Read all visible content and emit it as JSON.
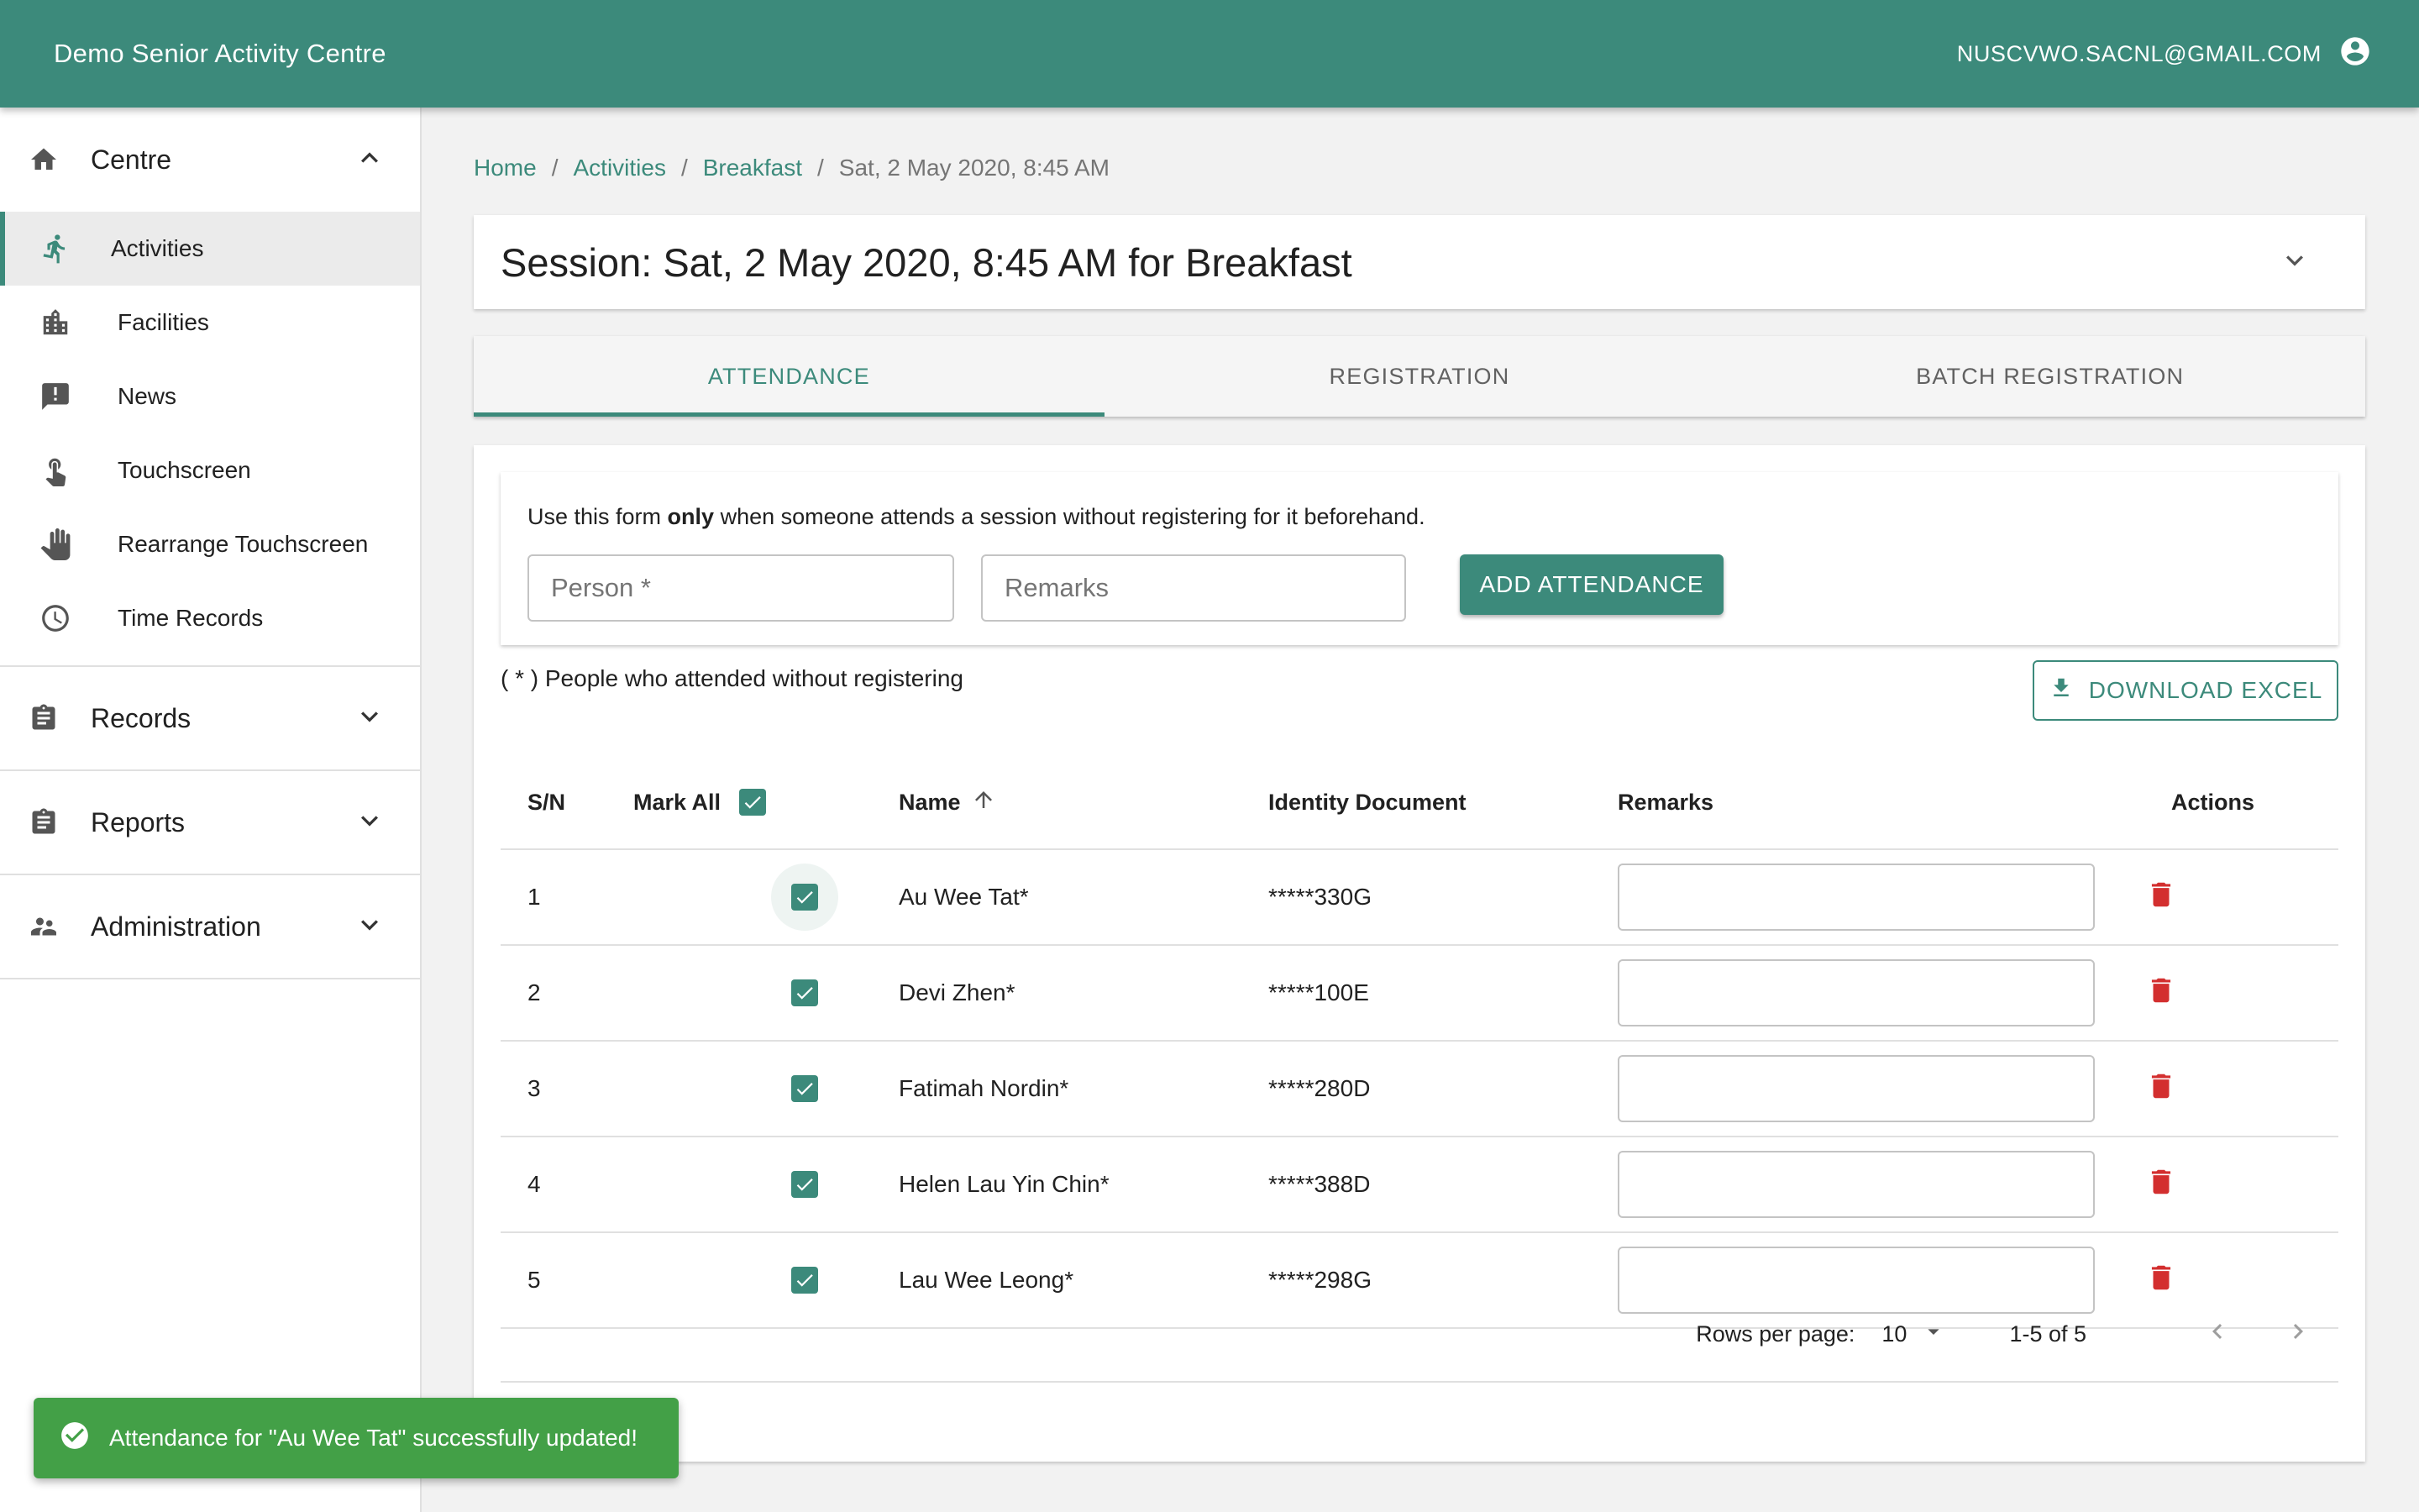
{
  "app": {
    "title": "Demo Senior Activity Centre",
    "account_email": "NUSCVWO.SACNL@GMAIL.COM"
  },
  "sidebar": {
    "groups": [
      {
        "label": "Centre",
        "icon": "home-icon",
        "expanded": true,
        "items": [
          {
            "label": "Activities",
            "icon": "run-icon",
            "active": true
          },
          {
            "label": "Facilities",
            "icon": "building-icon"
          },
          {
            "label": "News",
            "icon": "announcement-icon"
          },
          {
            "label": "Touchscreen",
            "icon": "touch-icon"
          },
          {
            "label": "Rearrange Touchscreen",
            "icon": "hand-icon"
          },
          {
            "label": "Time Records",
            "icon": "clock-icon"
          }
        ]
      },
      {
        "label": "Records",
        "icon": "clipboard-icon",
        "expanded": false
      },
      {
        "label": "Reports",
        "icon": "clipboard-icon",
        "expanded": false
      },
      {
        "label": "Administration",
        "icon": "people-icon",
        "expanded": false
      }
    ]
  },
  "breadcrumb": {
    "items": [
      "Home",
      "Activities",
      "Breakfast"
    ],
    "current": "Sat, 2 May 2020, 8:45 AM"
  },
  "session": {
    "title": "Session: Sat, 2 May 2020, 8:45 AM for Breakfast"
  },
  "tabs": [
    {
      "label": "ATTENDANCE",
      "active": true
    },
    {
      "label": "REGISTRATION",
      "active": false
    },
    {
      "label": "BATCH REGISTRATION",
      "active": false
    }
  ],
  "form": {
    "note_prefix": "Use this form ",
    "note_bold": "only",
    "note_suffix": " when someone attends a session without registering for it beforehand.",
    "person_placeholder": "Person *",
    "remarks_placeholder": "Remarks",
    "add_label": "ADD ATTENDANCE"
  },
  "legend_note": "( * ) People who attended without registering",
  "download_label": "DOWNLOAD EXCEL",
  "table": {
    "columns": {
      "sn": "S/N",
      "mark_all": "Mark All",
      "name": "Name",
      "identity": "Identity Document",
      "remarks": "Remarks",
      "actions": "Actions"
    },
    "rows": [
      {
        "sn": "1",
        "name": "Au Wee Tat*",
        "identity": "*****330G",
        "remarks": "",
        "checked": true
      },
      {
        "sn": "2",
        "name": "Devi Zhen*",
        "identity": "*****100E",
        "remarks": "",
        "checked": true
      },
      {
        "sn": "3",
        "name": "Fatimah Nordin*",
        "identity": "*****280D",
        "remarks": "",
        "checked": true
      },
      {
        "sn": "4",
        "name": "Helen Lau Yin Chin*",
        "identity": "*****388D",
        "remarks": "",
        "checked": true
      },
      {
        "sn": "5",
        "name": "Lau Wee Leong*",
        "identity": "*****298G",
        "remarks": "",
        "checked": true
      }
    ]
  },
  "pagination": {
    "rows_per_page_label": "Rows per page:",
    "rows_per_page": "10",
    "range": "1-5 of 5"
  },
  "snackbar": {
    "message": "Attendance for \"Au Wee Tat\" successfully updated!"
  },
  "colors": {
    "primary": "#3c8a7b",
    "danger": "#d32f2f",
    "success": "#43a047"
  }
}
